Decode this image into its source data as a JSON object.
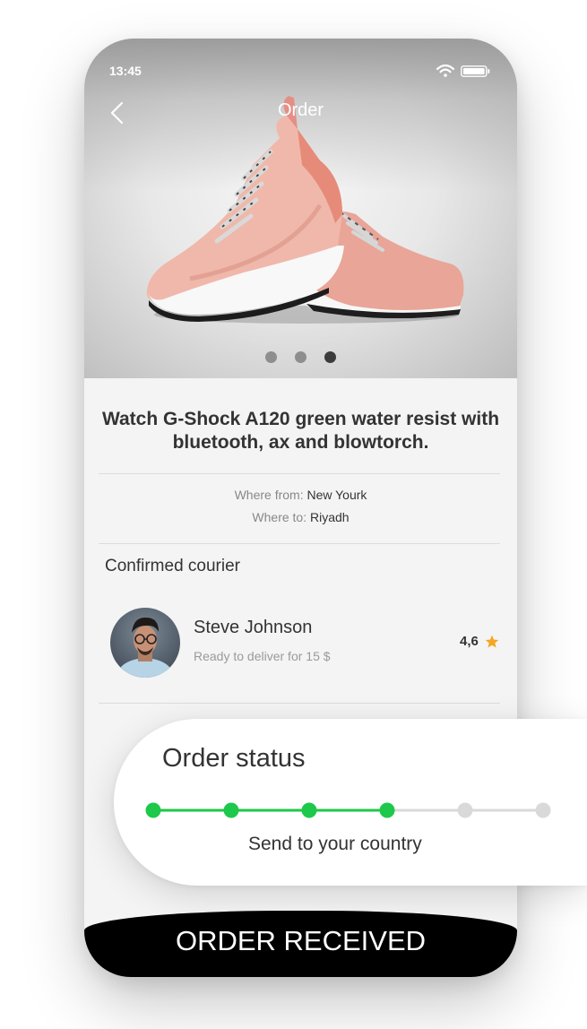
{
  "status_bar": {
    "time": "13:45",
    "wifi_icon": "wifi-icon",
    "battery_icon": "battery-icon"
  },
  "header": {
    "title": "Order",
    "back_icon": "chevron-left-icon"
  },
  "gallery": {
    "active_index": 2,
    "dot_count": 3
  },
  "product": {
    "name": "Watch G-Shock A120 green water resist with bluetooth, ax and blowtorch."
  },
  "route": {
    "from_label": "Where from:",
    "from_value": "New Yourk",
    "to_label": "Where to:",
    "to_value": "Riyadh"
  },
  "courier": {
    "section_title": "Confirmed courier",
    "name": "Steve Johnson",
    "subtitle": "Ready to deliver for 15 $",
    "rating": "4,6",
    "star_color": "#f5a623"
  },
  "order_status": {
    "heading": "Order status",
    "steps_total": 6,
    "steps_completed": 4,
    "current_step_label": "Send to your country",
    "active_color": "#1ec84a",
    "inactive_color": "#d9d9d9"
  },
  "bottom_action": {
    "label": "ORDER RECEIVED"
  }
}
